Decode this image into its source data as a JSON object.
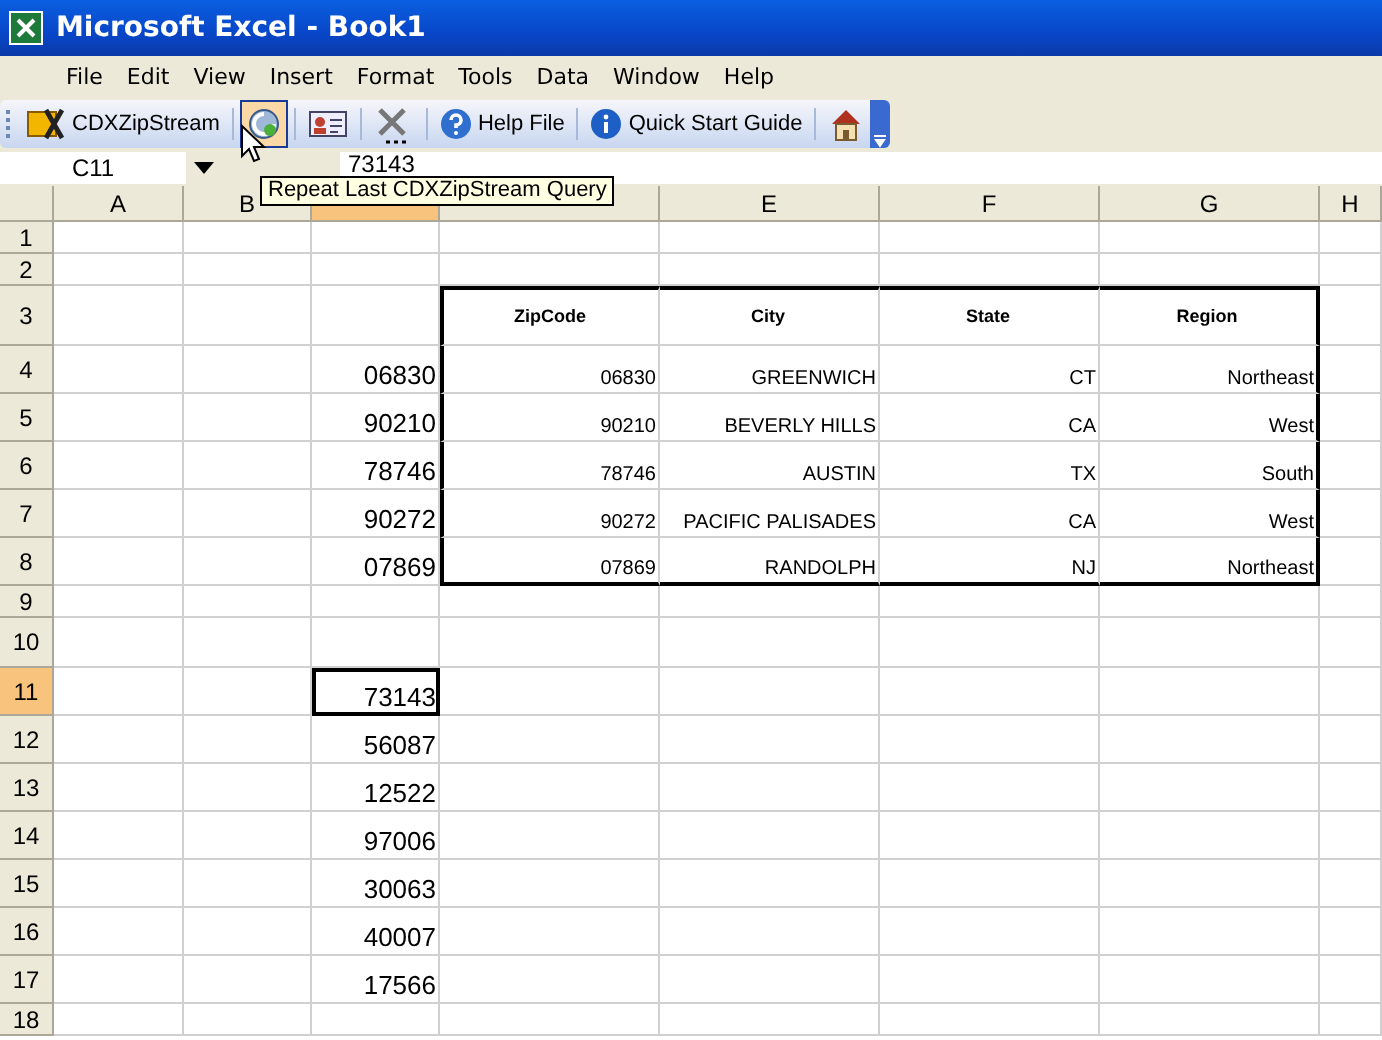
{
  "window": {
    "title": "Microsoft Excel - Book1"
  },
  "menu": [
    "File",
    "Edit",
    "View",
    "Insert",
    "Format",
    "Tools",
    "Data",
    "Window",
    "Help"
  ],
  "toolbar": [
    {
      "label": "CDXZipStream",
      "selected": false
    },
    {
      "selected": true
    },
    {
      "selected": false
    },
    {
      "selected": false
    },
    {
      "label": "Help File",
      "selected": false
    },
    {
      "label": "Quick Start Guide",
      "selected": false
    },
    {
      "selected": false
    }
  ],
  "tooltip": "Repeat Last CDXZipStream Query",
  "formula_bar": {
    "name_box": "C11",
    "value": "73143"
  },
  "columns": [
    {
      "label": "A",
      "selected": false
    },
    {
      "label": "B",
      "selected": false
    },
    {
      "selected": true
    },
    {
      "selected": false
    },
    {
      "label": "E",
      "selected": false
    },
    {
      "label": "F",
      "selected": false
    },
    {
      "label": "G",
      "selected": false
    },
    {
      "label": "H",
      "selected": false
    }
  ],
  "rows": [
    {
      "label": "1",
      "kind": "plain",
      "selected": false,
      "cells": {}
    },
    {
      "label": "2",
      "kind": "plain",
      "selected": false,
      "cells": {}
    },
    {
      "label": "3",
      "kind": "table_header",
      "selected": false,
      "cells": {
        "D": "ZipCode",
        "E": "City",
        "F": "State",
        "G": "Region"
      }
    },
    {
      "label": "4",
      "kind": "table_row",
      "selected": false,
      "cells": {
        "C": "06830",
        "D": "06830",
        "E": "GREENWICH",
        "F": "CT",
        "G": "Northeast"
      }
    },
    {
      "label": "5",
      "kind": "table_row",
      "selected": false,
      "cells": {
        "C": "90210",
        "D": "90210",
        "E": "BEVERLY HILLS",
        "F": "CA",
        "G": "West"
      }
    },
    {
      "label": "6",
      "kind": "table_row",
      "selected": false,
      "cells": {
        "C": "78746",
        "D": "78746",
        "E": "AUSTIN",
        "F": "TX",
        "G": "South"
      }
    },
    {
      "label": "7",
      "kind": "table_row",
      "selected": false,
      "cells": {
        "C": "90272",
        "D": "90272",
        "E": "PACIFIC PALISADES",
        "F": "CA",
        "G": "West"
      }
    },
    {
      "label": "8",
      "kind": "table_row",
      "selected": false,
      "cells": {
        "C": "07869",
        "D": "07869",
        "E": "RANDOLPH",
        "F": "NJ",
        "G": "Northeast"
      }
    },
    {
      "label": "9",
      "kind": "plain",
      "selected": false,
      "cells": {}
    },
    {
      "label": "10",
      "kind": "plain",
      "selected": false,
      "cells": {}
    },
    {
      "label": "11",
      "kind": "plain",
      "selected": true,
      "cells": {
        "C": "73143"
      }
    },
    {
      "label": "12",
      "kind": "plain",
      "selected": false,
      "cells": {
        "C": "56087"
      }
    },
    {
      "label": "13",
      "kind": "plain",
      "selected": false,
      "cells": {
        "C": "12522"
      }
    },
    {
      "label": "14",
      "kind": "plain",
      "selected": false,
      "cells": {
        "C": "97006"
      }
    },
    {
      "label": "15",
      "kind": "plain",
      "selected": false,
      "cells": {
        "C": "30063"
      }
    },
    {
      "label": "16",
      "kind": "plain",
      "selected": false,
      "cells": {
        "C": "40007"
      }
    },
    {
      "label": "17",
      "kind": "plain",
      "selected": false,
      "cells": {
        "C": "17566"
      }
    },
    {
      "label": "18",
      "kind": "plain",
      "selected": false,
      "cells": {}
    }
  ]
}
